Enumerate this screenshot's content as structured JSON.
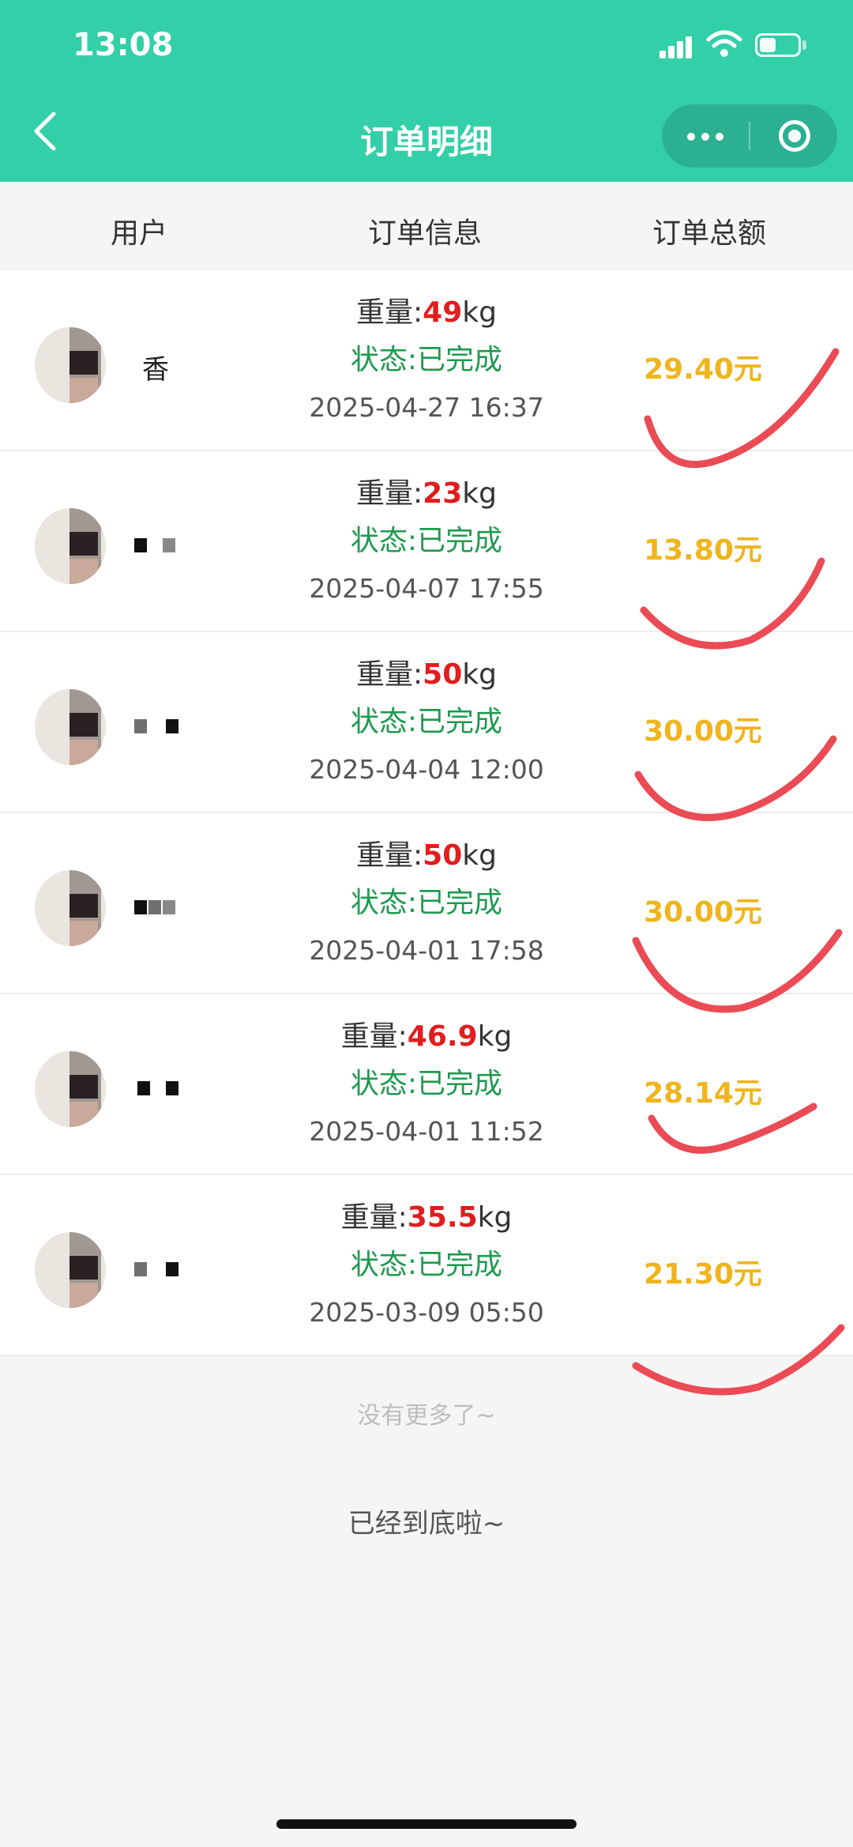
{
  "status_bar": {
    "time": "13:08"
  },
  "nav": {
    "title": "订单明细"
  },
  "columns": {
    "user": "用户",
    "info": "订单信息",
    "total": "订单总额"
  },
  "orders": [
    {
      "name_visible": "香",
      "weight_label": "重量:",
      "weight": "49",
      "unit": "kg",
      "status": "状态:已完成",
      "datetime": "2025-04-27 16:37",
      "amount": "29.40元"
    },
    {
      "name_visible": "",
      "weight_label": "重量:",
      "weight": "23",
      "unit": "kg",
      "status": "状态:已完成",
      "datetime": "2025-04-07 17:55",
      "amount": "13.80元"
    },
    {
      "name_visible": "",
      "weight_label": "重量:",
      "weight": "50",
      "unit": "kg",
      "status": "状态:已完成",
      "datetime": "2025-04-04 12:00",
      "amount": "30.00元"
    },
    {
      "name_visible": "",
      "weight_label": "重量:",
      "weight": "50",
      "unit": "kg",
      "status": "状态:已完成",
      "datetime": "2025-04-01 17:58",
      "amount": "30.00元"
    },
    {
      "name_visible": "",
      "weight_label": "重量:",
      "weight": "46.9",
      "unit": "kg",
      "status": "状态:已完成",
      "datetime": "2025-04-01 11:52",
      "amount": "28.14元"
    },
    {
      "name_visible": "",
      "weight_label": "重量:",
      "weight": "35.5",
      "unit": "kg",
      "status": "状态:已完成",
      "datetime": "2025-03-09 05:50",
      "amount": "21.30元"
    }
  ],
  "footer": {
    "no_more": "没有更多了~",
    "bottom": "已经到底啦~"
  },
  "colors": {
    "header": "#33cfa9",
    "weight": "#e11d1d",
    "status": "#1d9a4f",
    "amount": "#f0b41c",
    "annotation": "#ea4b55"
  },
  "icons": {
    "back": "chevron-left-icon",
    "more": "more-dots-icon",
    "close": "target-close-icon"
  }
}
